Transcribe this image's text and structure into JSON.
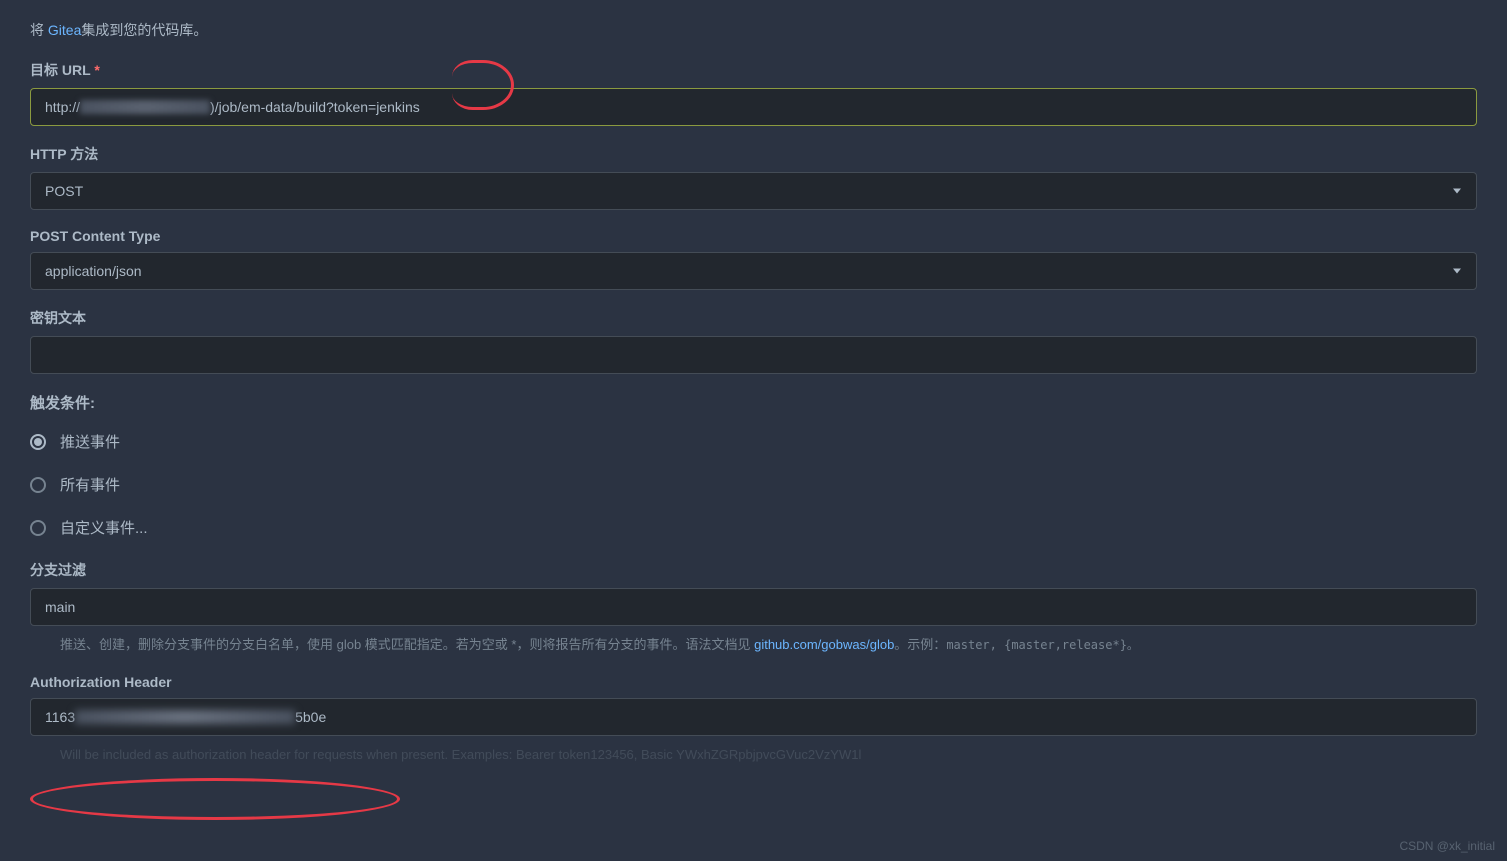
{
  "intro": {
    "prefix": "将 ",
    "link": "Gitea",
    "suffix": "集成到您的代码库。"
  },
  "fields": {
    "target_url": {
      "label": "目标 URL",
      "required": "*",
      "value_prefix": "http://",
      "value_suffix": ")/job/em-data/build?token=jenkins"
    },
    "http_method": {
      "label": "HTTP 方法",
      "value": "POST"
    },
    "content_type": {
      "label": "POST Content Type",
      "value": "application/json"
    },
    "secret": {
      "label": "密钥文本",
      "value": ""
    },
    "branch_filter": {
      "label": "分支过滤",
      "value": "main",
      "help_prefix": "推送、创建，删除分支事件的分支白名单，使用 glob 模式匹配指定。若为空或 *，则将报告所有分支的事件。语法文档见 ",
      "help_link": "github.com/gobwas/glob",
      "help_suffix": "。示例：",
      "help_code": "master, {master,release*}。"
    },
    "auth_header": {
      "label": "Authorization Header",
      "value_prefix": "1163",
      "value_suffix": "5b0e",
      "help": "Will be included as authorization header for requests when present. Examples: Bearer token123456, Basic YWxhZGRpbjpvcGVuc2VzYW1l"
    }
  },
  "trigger": {
    "header": "触发条件:",
    "options": {
      "push": "推送事件",
      "all": "所有事件",
      "custom": "自定义事件..."
    },
    "selected": "push"
  },
  "watermark": "CSDN @xk_initial"
}
